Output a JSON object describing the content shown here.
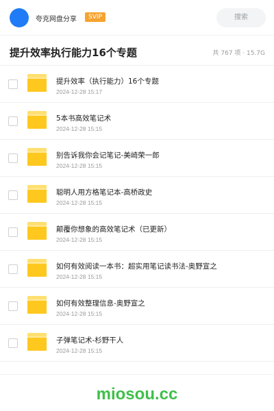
{
  "header": {
    "app_name": "夸克网盘分享",
    "badge": "SVIP",
    "search_label": "搜索"
  },
  "page": {
    "title": "提升效率执行能力16个专题",
    "summary": "共 767 项 · 15.7G"
  },
  "files": [
    {
      "name": "提升效率（执行能力）16个专题",
      "date": "2024-12-28 15:17"
    },
    {
      "name": "5本书高效笔记术",
      "date": "2024-12-28 15:15"
    },
    {
      "name": "别告诉我你会记笔记-美崎荣一郎",
      "date": "2024-12-28 15:15"
    },
    {
      "name": "聪明人用方格笔记本-高桥政史",
      "date": "2024-12-28 15:15"
    },
    {
      "name": "颠覆你想象的高效笔记术（已更新）",
      "date": "2024-12-28 15:15"
    },
    {
      "name": "如何有效阅读一本书：超实用笔记读书法-奥野宣之",
      "date": "2024-12-28 15:15"
    },
    {
      "name": "如何有效整理信息-奥野宣之",
      "date": "2024-12-28 15:15"
    },
    {
      "name": "子弹笔记术-杉野干人",
      "date": "2024-12-28 15:15"
    }
  ],
  "watermark": "miosou.cc",
  "colors": {
    "avatar": "#1f7cf6",
    "svip": "#f6a330",
    "folder": "#ffc81f",
    "watermark": "#3fbf4a"
  },
  "icons": {
    "folder": "folder-icon",
    "checkbox": "checkbox-icon"
  }
}
